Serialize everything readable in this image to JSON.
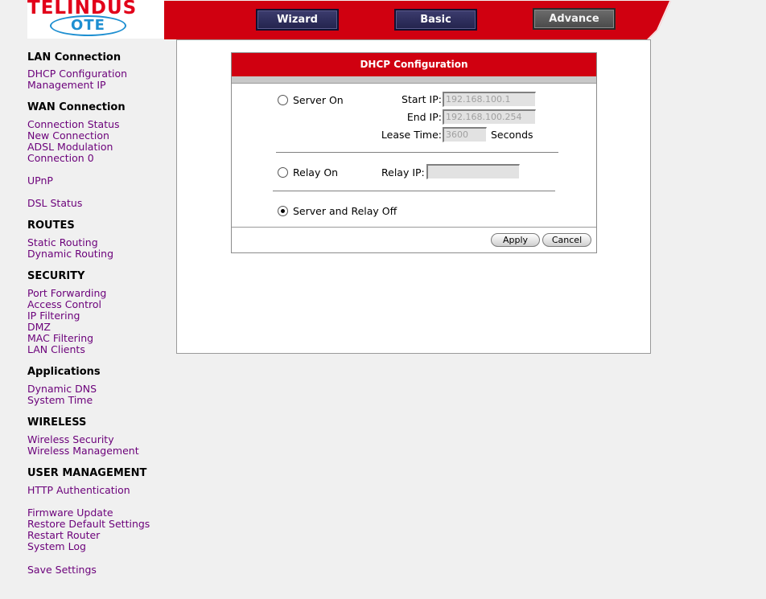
{
  "logo": {
    "brand": "TELINDUS",
    "sub": "OTE"
  },
  "nav_buttons": [
    {
      "label": "Wizard",
      "active": false
    },
    {
      "label": "Basic",
      "active": false
    },
    {
      "label": "Advance",
      "active": true
    }
  ],
  "colors": {
    "brand_red": "#d00010",
    "link_purple": "#6b007a",
    "logo_blue": "#1e8fd1"
  },
  "sidebar": {
    "lan_title": "LAN Connection",
    "lan_items": [
      "DHCP Configuration",
      "Management IP"
    ],
    "wan_title": "WAN Connection",
    "wan_items": [
      "Connection Status",
      "New Connection",
      "ADSL Modulation",
      "Connection 0"
    ],
    "upnp": "UPnP",
    "dsl_status": "DSL Status",
    "routes_title": "ROUTES",
    "routes_items": [
      "Static Routing",
      "Dynamic Routing"
    ],
    "security_title": "SECURITY",
    "security_items": [
      "Port Forwarding",
      "Access Control",
      "IP Filtering",
      "DMZ",
      "MAC Filtering",
      "LAN Clients"
    ],
    "applications_title": "Applications",
    "applications_items": [
      "Dynamic DNS",
      "System Time"
    ],
    "wireless_title": "WIRELESS",
    "wireless_items": [
      "Wireless Security",
      "Wireless Management"
    ],
    "user_mgmt_title": "USER MANAGEMENT",
    "user_mgmt_items": [
      "HTTP Authentication"
    ],
    "maintenance_items": [
      "Firmware Update",
      "Restore Default Settings",
      "Restart Router",
      "System Log"
    ],
    "save_settings": "Save Settings"
  },
  "dhcp": {
    "title": "DHCP Configuration",
    "server_on_label": "Server On",
    "start_ip_label": "Start IP:",
    "start_ip_value": "192.168.100.1",
    "end_ip_label": "End IP:",
    "end_ip_value": "192.168.100.254",
    "lease_time_label": "Lease Time:",
    "lease_time_value": "3600",
    "seconds_label": "Seconds",
    "relay_on_label": "Relay On",
    "relay_ip_label": "Relay IP:",
    "relay_ip_value": "",
    "off_label": "Server and Relay Off",
    "selected_mode": "Server and Relay Off",
    "apply_label": "Apply",
    "cancel_label": "Cancel"
  }
}
